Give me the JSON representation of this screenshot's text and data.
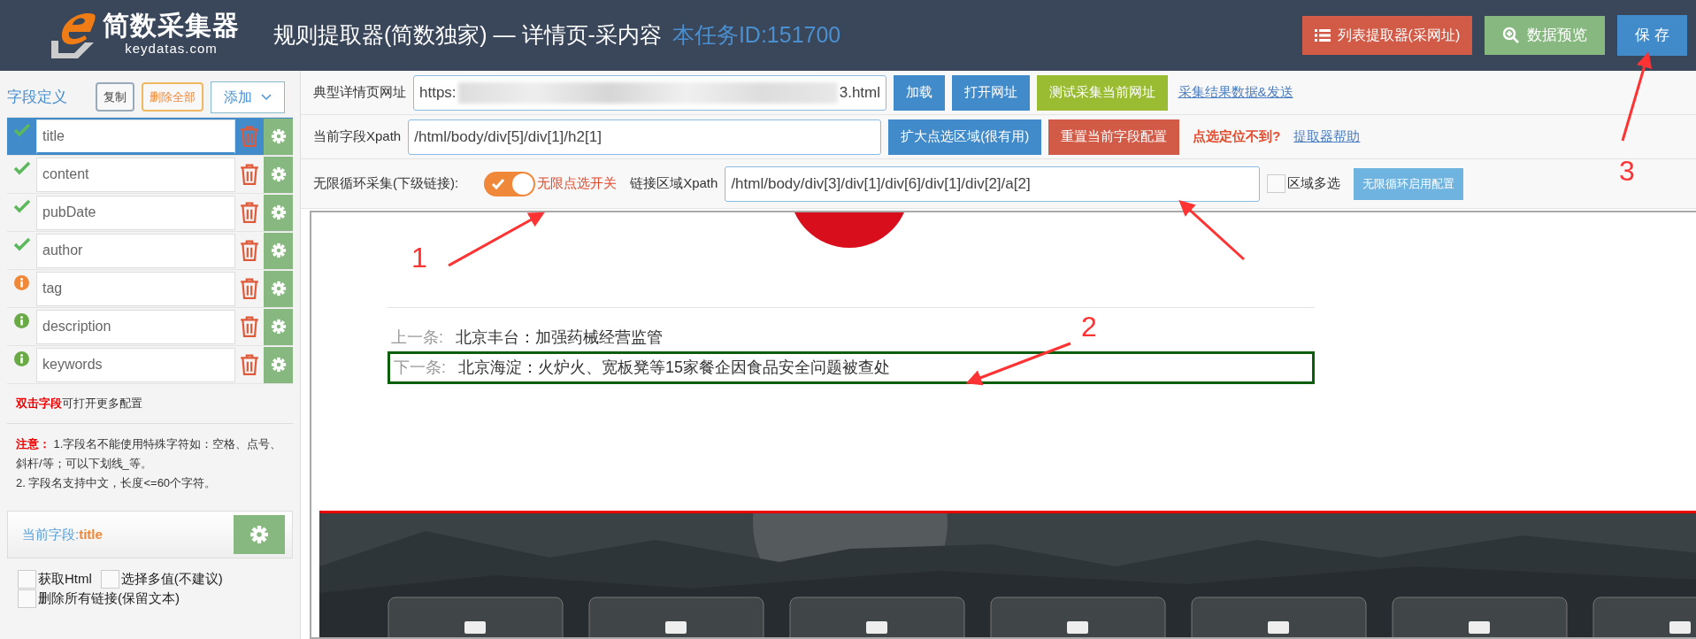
{
  "header": {
    "logo_text": "简数采集器",
    "logo_sub": "keydatas.com",
    "title": "规则提取器(简数独家) — 详情页-采内容",
    "task_id": "本任务ID:151700",
    "buttons": [
      {
        "label": "列表提取器(采网址)",
        "kind": "list"
      },
      {
        "label": "数据预览",
        "kind": "preview"
      },
      {
        "label": "保 存",
        "kind": "save"
      }
    ]
  },
  "sidebar": {
    "title": "字段定义",
    "actions": [
      {
        "label": "复制",
        "kind": "copy"
      },
      {
        "label": "删除全部",
        "kind": "delete"
      },
      {
        "label": "添加",
        "kind": "dropdown"
      }
    ],
    "fields": [
      {
        "name": "title",
        "kind": "check",
        "color": "#5cb85c",
        "selected": true
      },
      {
        "name": "content",
        "kind": "check",
        "color": "#5cb85c",
        "selected": false
      },
      {
        "name": "pubDate",
        "kind": "check",
        "color": "#5cb85c",
        "selected": false
      },
      {
        "name": "author",
        "kind": "check",
        "color": "#5cb85c",
        "selected": false
      },
      {
        "name": "tag",
        "kind": "info",
        "color": "#f0883a",
        "selected": false
      },
      {
        "name": "description",
        "kind": "info",
        "color": "#69aa46",
        "selected": false
      },
      {
        "name": "keywords",
        "kind": "info",
        "color": "#69aa46",
        "selected": false
      }
    ],
    "hint": "**双击字段**可打开更多配置",
    "notes": [
      "**注意：** 1.字段名不能使用特殊字符如：空格、点号、斜杆/等；可以下划线_等。",
      "2. 字段名支持中文，长度<=60个字符。"
    ],
    "current_label": "当前字段:",
    "current_field": "title",
    "options": [
      {
        "label": "获取Html",
        "checked": false
      },
      {
        "label": "选择多值(不建议)",
        "checked": false
      },
      {
        "label": "删除所有链接(保留文本)",
        "checked": false
      }
    ]
  },
  "toolbar": {
    "url_label": "典型详情页网址",
    "url_start": "https:",
    "url_end": "3.html",
    "row1_buttons": [
      {
        "label": "加载",
        "kind": "blue"
      },
      {
        "label": "打开网址",
        "kind": "blue"
      },
      {
        "label": "测试采集当前网址",
        "kind": "olive"
      }
    ],
    "row1_link": "采集结果数据&发送",
    "xpath_label": "当前字段Xpath",
    "xpath": "/html/body/div[5]/div[1]/h2[1]",
    "row2_buttons": [
      {
        "label": "扩大点选区域(很有用)",
        "kind": "blue"
      },
      {
        "label": "重置当前字段配置",
        "kind": "red"
      }
    ],
    "row2_warning": "点选定位不到?",
    "row2_link": "提取器帮助",
    "loop_label": "无限循环采集(下级链接):",
    "loop_on": true,
    "loop_switch_label": "无限点选开关",
    "link_xpath_label": "链接区域Xpath",
    "link_xpath": "/html/body/div[3]/div[1]/div[6]/div[1]/div[2]/a[2]",
    "multi_label": "区域多选",
    "multi_checked": false,
    "loop_config_button": "无限循环启用配置"
  },
  "preview": {
    "prev_label": "上一条:",
    "prev_title": "北京丰台：加强药械经营监管",
    "next_label": "下一条:",
    "next_title": "北京海淀：火炉火、宽板凳等15家餐企因食品安全问题被查处",
    "next_highlighted": true
  },
  "annotations": [
    {
      "kind": "numbered",
      "label": "1"
    },
    {
      "kind": "numbered",
      "label": "2"
    },
    {
      "kind": "arrow"
    },
    {
      "kind": "numbered",
      "label": "3"
    }
  ]
}
